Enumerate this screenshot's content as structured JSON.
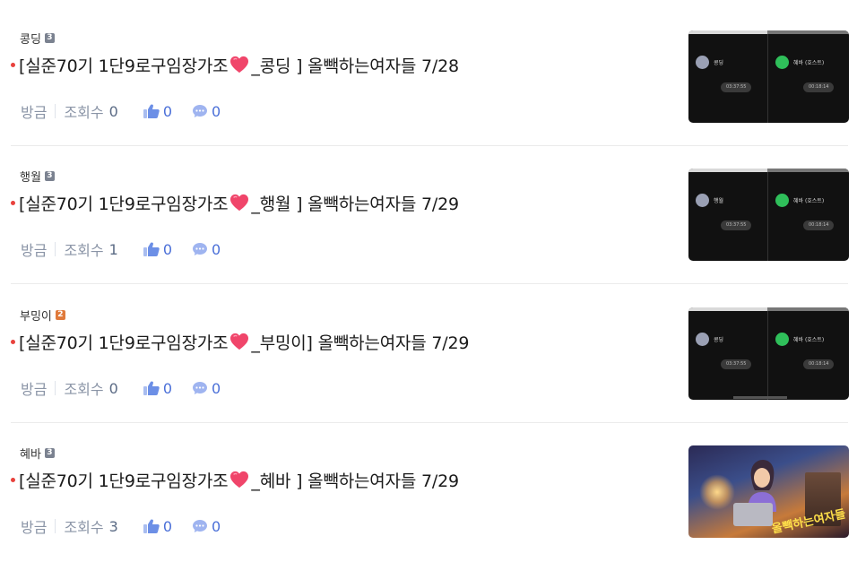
{
  "colors": {
    "bullet": "#e8413c",
    "level_3": "#7b8290",
    "level_2": "#e07a3b",
    "like": "#4a6fd8",
    "meta_gray": "#8a94a6"
  },
  "posts": [
    {
      "author": "콩딩",
      "level": "3",
      "title_prefix": "[실준70기 1단9로구임장가조",
      "title_suffix": "_콩딩 ] 올빽하는여자들 7/28",
      "board": "방금",
      "views_label": "조회수",
      "views": "0",
      "likes": "0",
      "comments": "0",
      "thumb": {
        "left_name": "콩딩",
        "right_name": "혜바 (호스트)",
        "left_time": "03:37:55",
        "right_time": "00:18:14"
      }
    },
    {
      "author": "행월",
      "level": "3",
      "title_prefix": "[실준70기 1단9로구임장가조",
      "title_suffix": "_행월 ] 올빽하는여자들 7/29",
      "board": "방금",
      "views_label": "조회수",
      "views": "1",
      "likes": "0",
      "comments": "0",
      "thumb": {
        "left_name": "행월",
        "right_name": "혜바 (호스트)",
        "left_time": "03:37:55",
        "right_time": "00:18:14"
      }
    },
    {
      "author": "부밍이",
      "level": "2",
      "title_prefix": "[실준70기 1단9로구임장가조",
      "title_suffix": "_부밍이] 올빽하는여자들 7/29",
      "board": "방금",
      "views_label": "조회수",
      "views": "0",
      "likes": "0",
      "comments": "0",
      "thumb": {
        "left_name": "콩딩",
        "right_name": "혜바 (호스트)",
        "left_time": "03:37:55",
        "right_time": "00:18:14"
      }
    },
    {
      "author": "혜바",
      "level": "3",
      "title_prefix": "[실준70기 1단9로구임장가조",
      "title_suffix": "_혜바 ] 올빽하는여자들 7/29",
      "board": "방금",
      "views_label": "조회수",
      "views": "3",
      "likes": "0",
      "comments": "0",
      "thumb": {
        "art_text": "올빽하는여자들"
      }
    }
  ]
}
